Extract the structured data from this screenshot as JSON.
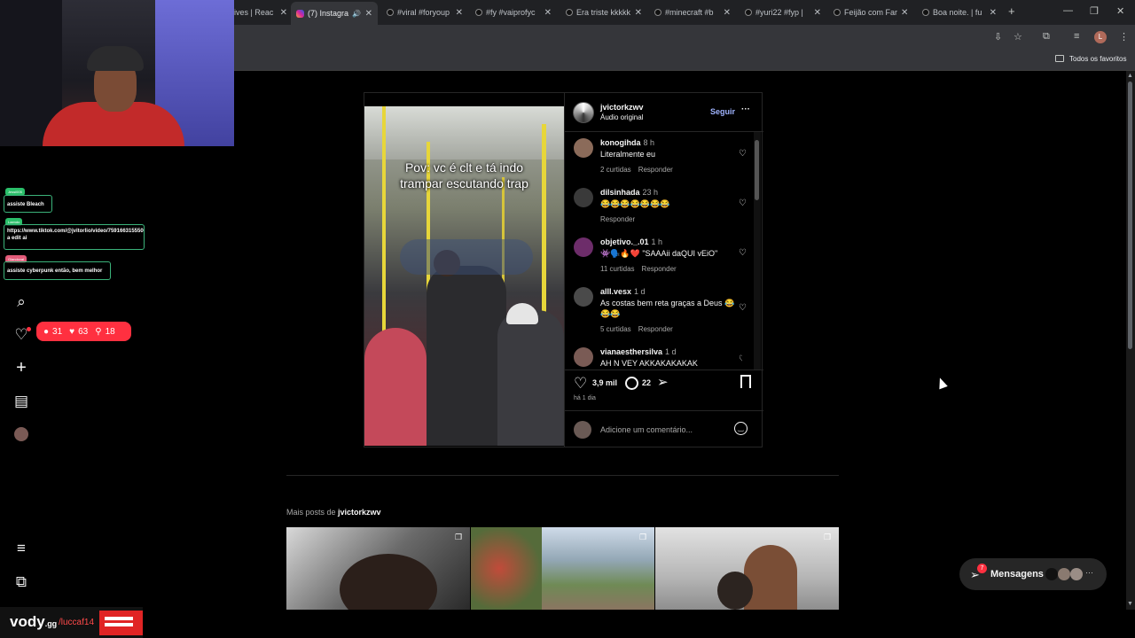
{
  "browser": {
    "tabs": [
      {
        "title": "ives | Reac",
        "icon": "none"
      },
      {
        "title": "(7) Instagra",
        "icon": "instagram-icon",
        "active": true
      },
      {
        "title": "#viral #foryoup",
        "icon": "tiktok-icon"
      },
      {
        "title": "#fy #vaiprofyc",
        "icon": "tiktok-icon"
      },
      {
        "title": "Era triste kkkkk",
        "icon": "tiktok-icon"
      },
      {
        "title": "#minecraft #b",
        "icon": "tiktok-icon"
      },
      {
        "title": "#yuri22 #fyp |",
        "icon": "tiktok-icon"
      },
      {
        "title": "Feijão com Far",
        "icon": "tiktok-icon"
      },
      {
        "title": "Boa noite. | fu",
        "icon": "tiktok-icon"
      }
    ],
    "new_tab": "+",
    "bookmarks_label": "Todos os favoritos",
    "profile_initial": "L"
  },
  "overlay_chat": {
    "messages": [
      {
        "user": "Jessi005",
        "text": "assiste Bleach",
        "tag_color": "#2bbf6a"
      },
      {
        "user": "Laendo",
        "text": "https://www.tiktok.com/@jvitorlio/video/7591663155500926992? a edit ai",
        "tag_color": "#2bbf6a"
      },
      {
        "user": "Glandoval",
        "text": "assiste cyberpunk então, bem melhor",
        "tag_color": "#e35b7a"
      }
    ]
  },
  "sidebar": {
    "notification_badge": {
      "comments": "31",
      "likes": "63",
      "followers": "18"
    }
  },
  "post": {
    "username": "jvictorkzwv",
    "audio": "Áudio original",
    "follow_label": "Seguir",
    "more_label": "···",
    "video_caption_line1": "Pov: vc é clt e tá indo",
    "video_caption_line2": "trampar escutando trap",
    "comments": [
      {
        "user": "konogihda",
        "time": "8 h",
        "text": "Literalmente eu",
        "likes": "2 curtidas",
        "reply": "Responder"
      },
      {
        "user": "dilsinhada",
        "time": "23 h",
        "text": "😂😂😂😂😂😂😂",
        "likes": "",
        "reply": "Responder"
      },
      {
        "user": "objetivo._.01",
        "time": "1 h",
        "text": "👾🗣️🔥❤️ \"SAAAii daQUI vEiO\"",
        "likes": "11 curtidas",
        "reply": "Responder"
      },
      {
        "user": "alll.vesx",
        "time": "1 d",
        "text": "As costas bem reta graças a Deus 😂😂😂",
        "likes": "5 curtidas",
        "reply": "Responder"
      },
      {
        "user": "vianaesthersilva",
        "time": "1 d",
        "text": "AH N VEY AKKAKAKAKAK",
        "likes": "",
        "reply": ""
      }
    ],
    "like_count": "3,9 mil",
    "comment_count": "22",
    "posted_ago": "há 1 dia",
    "add_comment_placeholder": "Adicione um comentário..."
  },
  "more_posts": {
    "label_prefix": "Mais posts de ",
    "username": "jvictorkzwv"
  },
  "messages_button": {
    "label": "Mensagens",
    "badge": "7"
  },
  "watermark": {
    "brand": "vody",
    "domain": ".gg",
    "handle": "/luccaf14"
  },
  "colors": {
    "accent": "#4a5df9",
    "link": "#a0b4ff",
    "notification": "#ff3040"
  }
}
